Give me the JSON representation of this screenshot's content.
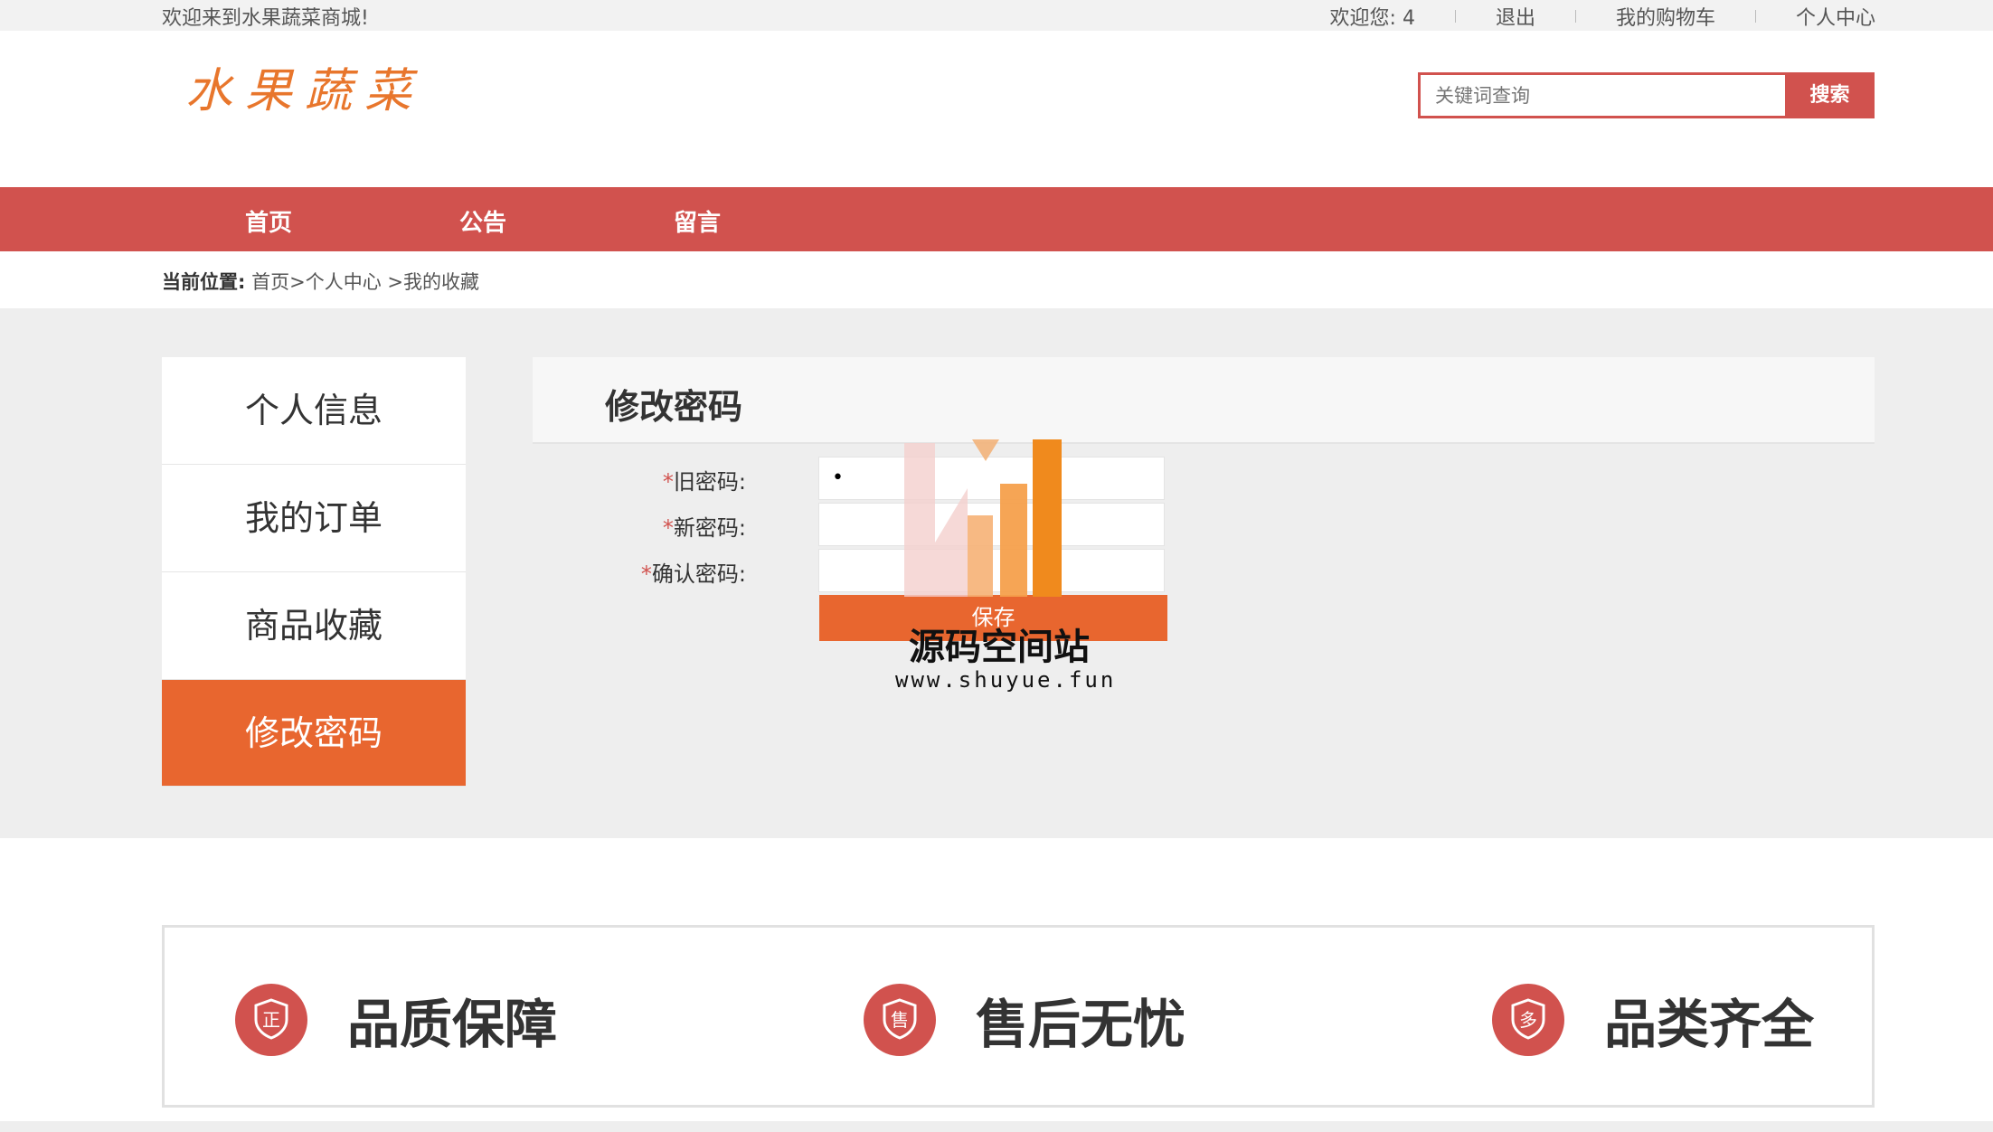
{
  "topbar": {
    "welcome": "欢迎来到水果蔬菜商城!",
    "greeting": "欢迎您:  4",
    "logout": "退出",
    "cart": "我的购物车",
    "profile": "个人中心"
  },
  "header": {
    "logo": "水果蔬菜",
    "search_placeholder": "关键词查询",
    "search_button": "搜索"
  },
  "nav": {
    "items": [
      "首页",
      "公告",
      "留言"
    ]
  },
  "breadcrumb": {
    "label": "当前位置:",
    "path": "首页>个人中心 >我的收藏"
  },
  "sidebar": {
    "items": [
      "个人信息",
      "我的订单",
      "商品收藏",
      "修改密码"
    ],
    "active": "修改密码"
  },
  "panel": {
    "title": "修改密码",
    "fields": [
      {
        "required": "*",
        "label": "旧密码:",
        "value": "•"
      },
      {
        "required": "*",
        "label": "新密码:",
        "value": ""
      },
      {
        "required": "*",
        "label": "确认密码:",
        "value": ""
      }
    ],
    "save": "保存"
  },
  "watermark": {
    "name": "源码空间站",
    "url": "www.shuyue.fun"
  },
  "features": [
    "品质保障",
    "售后无忧",
    "品类齐全"
  ],
  "feature_badges": [
    "正",
    "售",
    "多"
  ],
  "colors": {
    "brand_red": "#d1524e",
    "accent_orange": "#e8662f",
    "logo_orange": "#e8762c",
    "gray_bg": "#eeeeee"
  }
}
